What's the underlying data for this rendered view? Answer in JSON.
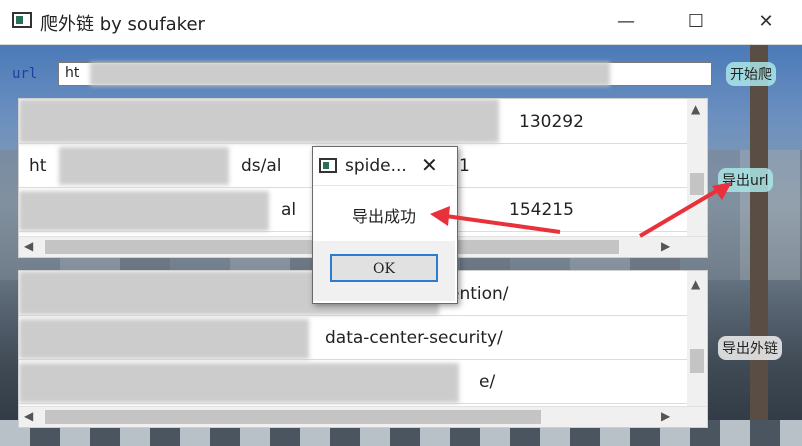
{
  "window": {
    "title": "爬外链  by soufaker",
    "minimize_glyph": "—",
    "maximize_glyph": "☐",
    "close_glyph": "✕"
  },
  "url": {
    "label": "url",
    "value": "ht"
  },
  "buttons": {
    "start_crawl": "开始爬",
    "export_url": "导出url",
    "export_links": "导出外链"
  },
  "top_list": {
    "rows": [
      {
        "start": "",
        "mid": "",
        "end": "130292"
      },
      {
        "start": "ht",
        "mid": "ds/al",
        "end": "1"
      },
      {
        "start": "",
        "mid": "al",
        "end": "154215"
      }
    ]
  },
  "bottom_list": {
    "rows": [
      {
        "start": "",
        "end": "ention/"
      },
      {
        "start": "",
        "end": "data-center-security/"
      },
      {
        "start": "",
        "end": "e/"
      }
    ]
  },
  "dialog": {
    "title": "spide...",
    "message": "导出成功",
    "ok_label": "OK",
    "close_glyph": "✕"
  },
  "colors": {
    "annotation_arrow": "#e8313b",
    "focus_border": "#2b7cd3"
  }
}
